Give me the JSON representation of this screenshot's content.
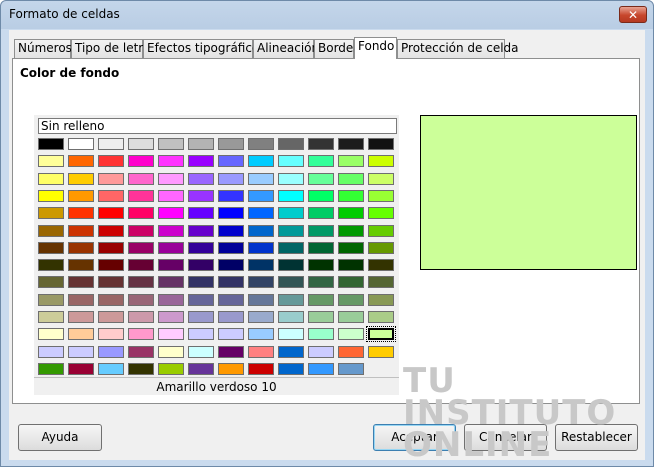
{
  "window": {
    "title": "Formato de celdas",
    "close_glyph": "✕"
  },
  "tabs": [
    {
      "label": "Números"
    },
    {
      "label": "Tipo de letra"
    },
    {
      "label": "Efectos tipográficos"
    },
    {
      "label": "Alineación"
    },
    {
      "label": "Bordes"
    },
    {
      "label": "Fondo",
      "active": true
    },
    {
      "label": "Protección de celda"
    }
  ],
  "panel": {
    "section_label": "Color de fondo",
    "no_fill_label": "Sin relleno",
    "selected_color_name": "Amarillo verdoso 10",
    "preview_color": "#ccff99"
  },
  "palette": [
    [
      "#000000",
      "#ffffff",
      "#eeeeee",
      "#dddddd",
      "#c0c0c0",
      "#b3b3b3",
      "#999999",
      "#808080",
      "#666666",
      "#333333",
      "#1c1c1c",
      "#111111"
    ],
    [
      "#ffff99",
      "#ff6600",
      "#ff3333",
      "#ff00cc",
      "#ff33ff",
      "#9900ff",
      "#6666ff",
      "#00ccff",
      "#66ffff",
      "#33ff99",
      "#99ff66",
      "#ccff00"
    ],
    [
      "#ffff66",
      "#ffcc00",
      "#ff9999",
      "#ff66cc",
      "#ff99ff",
      "#9966ff",
      "#9999ff",
      "#99ccff",
      "#99ffff",
      "#66ff99",
      "#66ff66",
      "#ccff66"
    ],
    [
      "#ffff00",
      "#ff9900",
      "#ff6666",
      "#ff3399",
      "#ff66ff",
      "#9933ff",
      "#3333ff",
      "#3399ff",
      "#00ffff",
      "#00ff66",
      "#33ff33",
      "#99ff33"
    ],
    [
      "#cc9900",
      "#ff3300",
      "#ff0000",
      "#ff0066",
      "#ff00ff",
      "#6600ff",
      "#0000ff",
      "#0066ff",
      "#00cccc",
      "#00cc66",
      "#00cc00",
      "#66ff00"
    ],
    [
      "#996600",
      "#cc3300",
      "#cc0000",
      "#cc0066",
      "#cc00cc",
      "#6600cc",
      "#0000cc",
      "#0066cc",
      "#009999",
      "#009966",
      "#009900",
      "#66cc00"
    ],
    [
      "#663300",
      "#993300",
      "#990000",
      "#990066",
      "#990099",
      "#330099",
      "#000099",
      "#0033cc",
      "#006666",
      "#006633",
      "#006600",
      "#669900"
    ],
    [
      "#333300",
      "#663300",
      "#660000",
      "#660033",
      "#660066",
      "#330066",
      "#000066",
      "#003366",
      "#003333",
      "#003300",
      "#003300",
      "#333300"
    ],
    [
      "#666633",
      "#663333",
      "#663333",
      "#663344",
      "#663366",
      "#333366",
      "#333366",
      "#334466",
      "#335555",
      "#336644",
      "#336633",
      "#556633"
    ],
    [
      "#999966",
      "#996666",
      "#996666",
      "#996677",
      "#996699",
      "#666699",
      "#666699",
      "#667799",
      "#669999",
      "#669966",
      "#669966",
      "#889955"
    ],
    [
      "#cccc99",
      "#cc9999",
      "#cc9999",
      "#cc99aa",
      "#cc99cc",
      "#9999cc",
      "#9999cc",
      "#99aacc",
      "#99cccc",
      "#99cc99",
      "#99cc99",
      "#aacc88"
    ],
    [
      "#ffffcc",
      "#ffcc99",
      "#ffcccc",
      "#ff99cc",
      "#ffccff",
      "#ccccff",
      "#ccccff",
      "#99ccff",
      "#ccffff",
      "#99ffcc",
      "#ccffcc",
      "#ccff99"
    ],
    [
      "#ccccff",
      "#ccccff",
      "#9999ff",
      "#993366",
      "#ffffcc",
      "#ccffff",
      "#660066",
      "#ff8080",
      "#0066cc",
      "#ccccff",
      "#ff6633",
      "#ffcc00"
    ],
    [
      "#339900",
      "#990033",
      "#66ccff",
      "#333300",
      "#99cc00",
      "#663399",
      "#ff9900",
      "#cc0000",
      "#0066cc",
      "#3399ff",
      "#6699cc",
      "#336699"
    ]
  ],
  "palette_rows_filled": [
    12,
    12,
    12,
    12,
    12,
    12,
    12,
    12,
    12,
    12,
    12,
    12,
    12,
    11
  ],
  "selected_swatch": {
    "row": 11,
    "col": 11
  },
  "watermark": {
    "line1": "TU",
    "line2": "INSTITUTO",
    "line3": "ONLINE"
  },
  "buttons": {
    "help": "Ayuda",
    "ok": "Aceptar",
    "cancel": "Cancelar",
    "reset": "Restablecer"
  }
}
